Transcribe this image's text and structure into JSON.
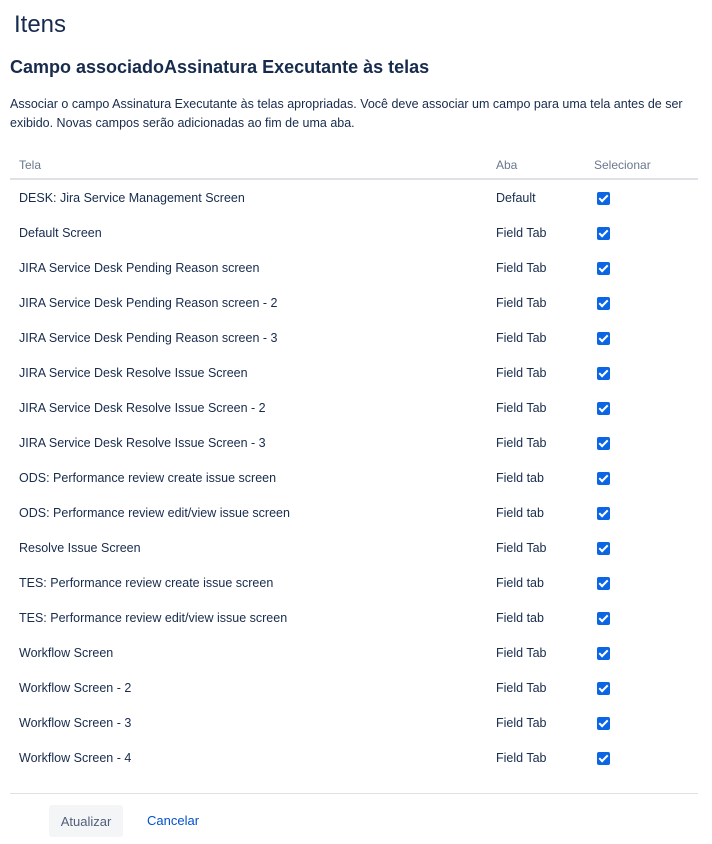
{
  "page": {
    "title": "Itens",
    "section_title": "Campo associadoAssinatura Executante às telas",
    "description": "Associar o campo Assinatura Executante às telas apropriadas. Você deve associar um campo para uma tela antes de ser exibido. Novas campos serão adicionadas ao fim de uma aba."
  },
  "table": {
    "headers": {
      "screen": "Tela",
      "tab": "Aba",
      "select": "Selecionar"
    },
    "rows": [
      {
        "screen": "DESK: Jira Service Management Screen",
        "tab": "Default",
        "checked": true
      },
      {
        "screen": "Default Screen",
        "tab": "Field Tab",
        "checked": true
      },
      {
        "screen": "JIRA Service Desk Pending Reason screen",
        "tab": "Field Tab",
        "checked": true
      },
      {
        "screen": "JIRA Service Desk Pending Reason screen - 2",
        "tab": "Field Tab",
        "checked": true
      },
      {
        "screen": "JIRA Service Desk Pending Reason screen - 3",
        "tab": "Field Tab",
        "checked": true
      },
      {
        "screen": "JIRA Service Desk Resolve Issue Screen",
        "tab": "Field Tab",
        "checked": true
      },
      {
        "screen": "JIRA Service Desk Resolve Issue Screen - 2",
        "tab": "Field Tab",
        "checked": true
      },
      {
        "screen": "JIRA Service Desk Resolve Issue Screen - 3",
        "tab": "Field Tab",
        "checked": true
      },
      {
        "screen": "ODS: Performance review create issue screen",
        "tab": "Field tab",
        "checked": true
      },
      {
        "screen": "ODS: Performance review edit/view issue screen",
        "tab": "Field tab",
        "checked": true
      },
      {
        "screen": "Resolve Issue Screen",
        "tab": "Field Tab",
        "checked": true
      },
      {
        "screen": "TES: Performance review create issue screen",
        "tab": "Field tab",
        "checked": true
      },
      {
        "screen": "TES: Performance review edit/view issue screen",
        "tab": "Field tab",
        "checked": true
      },
      {
        "screen": "Workflow Screen",
        "tab": "Field Tab",
        "checked": true
      },
      {
        "screen": "Workflow Screen - 2",
        "tab": "Field Tab",
        "checked": true
      },
      {
        "screen": "Workflow Screen - 3",
        "tab": "Field Tab",
        "checked": true
      },
      {
        "screen": "Workflow Screen - 4",
        "tab": "Field Tab",
        "checked": true
      }
    ]
  },
  "footer": {
    "update_label": "Atualizar",
    "cancel_label": "Cancelar"
  },
  "colors": {
    "checkbox": "#0c66e4",
    "link": "#0052cc",
    "text": "#172b4d"
  }
}
